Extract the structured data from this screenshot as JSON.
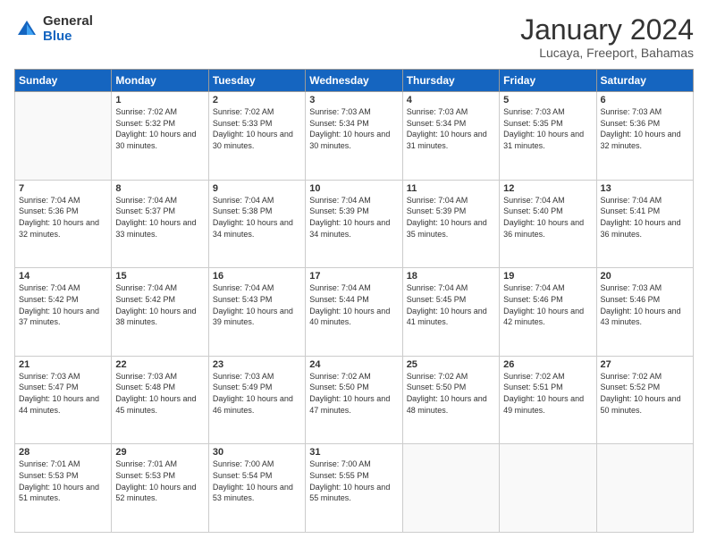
{
  "header": {
    "logo_general": "General",
    "logo_blue": "Blue",
    "title": "January 2024",
    "location": "Lucaya, Freeport, Bahamas"
  },
  "days_of_week": [
    "Sunday",
    "Monday",
    "Tuesday",
    "Wednesday",
    "Thursday",
    "Friday",
    "Saturday"
  ],
  "weeks": [
    [
      {
        "num": "",
        "empty": true
      },
      {
        "num": "1",
        "sunrise": "7:02 AM",
        "sunset": "5:32 PM",
        "daylight": "10 hours and 30 minutes."
      },
      {
        "num": "2",
        "sunrise": "7:02 AM",
        "sunset": "5:33 PM",
        "daylight": "10 hours and 30 minutes."
      },
      {
        "num": "3",
        "sunrise": "7:03 AM",
        "sunset": "5:34 PM",
        "daylight": "10 hours and 30 minutes."
      },
      {
        "num": "4",
        "sunrise": "7:03 AM",
        "sunset": "5:34 PM",
        "daylight": "10 hours and 31 minutes."
      },
      {
        "num": "5",
        "sunrise": "7:03 AM",
        "sunset": "5:35 PM",
        "daylight": "10 hours and 31 minutes."
      },
      {
        "num": "6",
        "sunrise": "7:03 AM",
        "sunset": "5:36 PM",
        "daylight": "10 hours and 32 minutes."
      }
    ],
    [
      {
        "num": "7",
        "sunrise": "7:04 AM",
        "sunset": "5:36 PM",
        "daylight": "10 hours and 32 minutes."
      },
      {
        "num": "8",
        "sunrise": "7:04 AM",
        "sunset": "5:37 PM",
        "daylight": "10 hours and 33 minutes."
      },
      {
        "num": "9",
        "sunrise": "7:04 AM",
        "sunset": "5:38 PM",
        "daylight": "10 hours and 34 minutes."
      },
      {
        "num": "10",
        "sunrise": "7:04 AM",
        "sunset": "5:39 PM",
        "daylight": "10 hours and 34 minutes."
      },
      {
        "num": "11",
        "sunrise": "7:04 AM",
        "sunset": "5:39 PM",
        "daylight": "10 hours and 35 minutes."
      },
      {
        "num": "12",
        "sunrise": "7:04 AM",
        "sunset": "5:40 PM",
        "daylight": "10 hours and 36 minutes."
      },
      {
        "num": "13",
        "sunrise": "7:04 AM",
        "sunset": "5:41 PM",
        "daylight": "10 hours and 36 minutes."
      }
    ],
    [
      {
        "num": "14",
        "sunrise": "7:04 AM",
        "sunset": "5:42 PM",
        "daylight": "10 hours and 37 minutes."
      },
      {
        "num": "15",
        "sunrise": "7:04 AM",
        "sunset": "5:42 PM",
        "daylight": "10 hours and 38 minutes."
      },
      {
        "num": "16",
        "sunrise": "7:04 AM",
        "sunset": "5:43 PM",
        "daylight": "10 hours and 39 minutes."
      },
      {
        "num": "17",
        "sunrise": "7:04 AM",
        "sunset": "5:44 PM",
        "daylight": "10 hours and 40 minutes."
      },
      {
        "num": "18",
        "sunrise": "7:04 AM",
        "sunset": "5:45 PM",
        "daylight": "10 hours and 41 minutes."
      },
      {
        "num": "19",
        "sunrise": "7:04 AM",
        "sunset": "5:46 PM",
        "daylight": "10 hours and 42 minutes."
      },
      {
        "num": "20",
        "sunrise": "7:03 AM",
        "sunset": "5:46 PM",
        "daylight": "10 hours and 43 minutes."
      }
    ],
    [
      {
        "num": "21",
        "sunrise": "7:03 AM",
        "sunset": "5:47 PM",
        "daylight": "10 hours and 44 minutes."
      },
      {
        "num": "22",
        "sunrise": "7:03 AM",
        "sunset": "5:48 PM",
        "daylight": "10 hours and 45 minutes."
      },
      {
        "num": "23",
        "sunrise": "7:03 AM",
        "sunset": "5:49 PM",
        "daylight": "10 hours and 46 minutes."
      },
      {
        "num": "24",
        "sunrise": "7:02 AM",
        "sunset": "5:50 PM",
        "daylight": "10 hours and 47 minutes."
      },
      {
        "num": "25",
        "sunrise": "7:02 AM",
        "sunset": "5:50 PM",
        "daylight": "10 hours and 48 minutes."
      },
      {
        "num": "26",
        "sunrise": "7:02 AM",
        "sunset": "5:51 PM",
        "daylight": "10 hours and 49 minutes."
      },
      {
        "num": "27",
        "sunrise": "7:02 AM",
        "sunset": "5:52 PM",
        "daylight": "10 hours and 50 minutes."
      }
    ],
    [
      {
        "num": "28",
        "sunrise": "7:01 AM",
        "sunset": "5:53 PM",
        "daylight": "10 hours and 51 minutes."
      },
      {
        "num": "29",
        "sunrise": "7:01 AM",
        "sunset": "5:53 PM",
        "daylight": "10 hours and 52 minutes."
      },
      {
        "num": "30",
        "sunrise": "7:00 AM",
        "sunset": "5:54 PM",
        "daylight": "10 hours and 53 minutes."
      },
      {
        "num": "31",
        "sunrise": "7:00 AM",
        "sunset": "5:55 PM",
        "daylight": "10 hours and 55 minutes."
      },
      {
        "num": "",
        "empty": true
      },
      {
        "num": "",
        "empty": true
      },
      {
        "num": "",
        "empty": true
      }
    ]
  ]
}
